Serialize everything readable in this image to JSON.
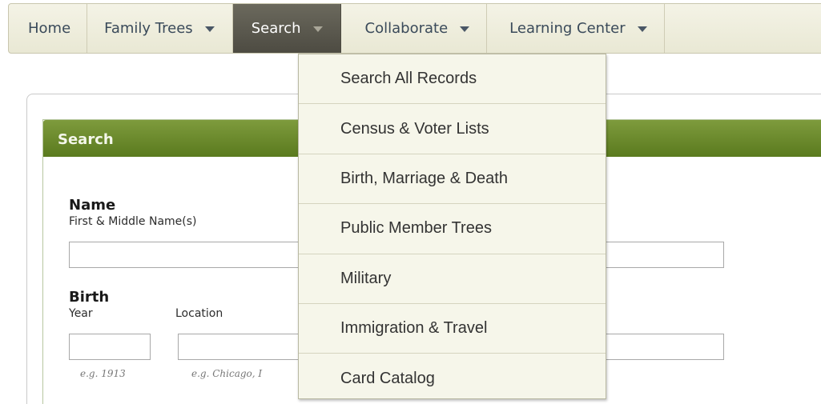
{
  "nav": {
    "tabs": [
      {
        "label": "Home",
        "has_menu": false
      },
      {
        "label": "Family Trees",
        "has_menu": true
      },
      {
        "label": "Search",
        "has_menu": true,
        "active": true
      },
      {
        "label": "Collaborate",
        "has_menu": true
      },
      {
        "label": "Learning Center",
        "has_menu": true
      }
    ]
  },
  "search_menu": {
    "items": [
      "Search All Records",
      "Census & Voter Lists",
      "Birth, Marriage & Death",
      "Public Member Trees",
      "Military",
      "Immigration & Travel",
      "Card Catalog"
    ]
  },
  "panel": {
    "title": "Search",
    "name_section": {
      "heading": "Name",
      "first_label": "First & Middle Name(s)",
      "first_value": "",
      "last_value": ""
    },
    "birth_section": {
      "heading": "Birth",
      "year_label": "Year",
      "year_value": "",
      "year_hint": "e.g. 1913",
      "location_label": "Location",
      "location_value": "",
      "location_hint": "e.g. Chicago, I"
    }
  },
  "colors": {
    "nav_active": "#5b594e",
    "panel_header": "#6a8a2a",
    "menu_bg": "#f6f6ea"
  }
}
